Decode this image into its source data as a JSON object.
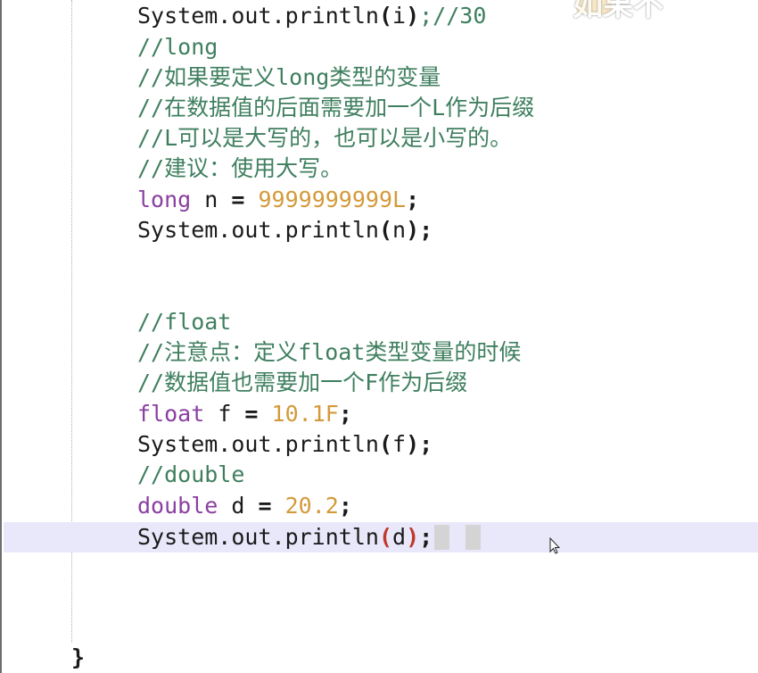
{
  "watermark": {
    "text": "如果不"
  },
  "code": {
    "l1": {
      "a": "System.out.println",
      "p1": "(",
      "arg": "i",
      "p2": ")",
      "rest": ";//30"
    },
    "l2": {
      "comment": "//long"
    },
    "l3": {
      "comment": "//如果要定义long类型的变量"
    },
    "l4": {
      "comment": "//在数据值的后面需要加一个L作为后缀"
    },
    "l5": {
      "comment": "//L可以是大写的，也可以是小写的。"
    },
    "l6": {
      "comment": "//建议：使用大写。"
    },
    "l7": {
      "kw": "long",
      "name": " n ",
      "eq": "=",
      "sp": " ",
      "val": "9999999999L",
      "semi": ";"
    },
    "l8": {
      "a": "System.out.println",
      "p1": "(",
      "arg": "n",
      "p2": ")",
      "semi": ";"
    },
    "l9": {
      "comment": "//float"
    },
    "l10": {
      "comment": "//注意点：定义float类型变量的时候"
    },
    "l11": {
      "comment": "//数据值也需要加一个F作为后缀"
    },
    "l12": {
      "kw": "float",
      "name": " f ",
      "eq": "=",
      "sp": " ",
      "val": "10.1F",
      "semi": ";"
    },
    "l13": {
      "a": "System.out.println",
      "p1": "(",
      "arg": "f",
      "p2": ")",
      "semi": ";"
    },
    "l14": {
      "comment": "//double"
    },
    "l15": {
      "kw": "double",
      "name": " d ",
      "eq": "=",
      "sp": " ",
      "val": "20.2",
      "semi": ";"
    },
    "l16": {
      "a": "System.out.println",
      "p1": "(",
      "arg": "d",
      "p2": ")",
      "semi": ";"
    },
    "closing_brace": "}"
  },
  "colors": {
    "comment": "#3f7f5f",
    "keyword": "#8a3fa0",
    "number": "#d49a3a",
    "current_line": "#e8e8fa",
    "matching_bracket": "#c0392b"
  },
  "icons": {
    "cursor": "mouse-pointer-icon"
  }
}
